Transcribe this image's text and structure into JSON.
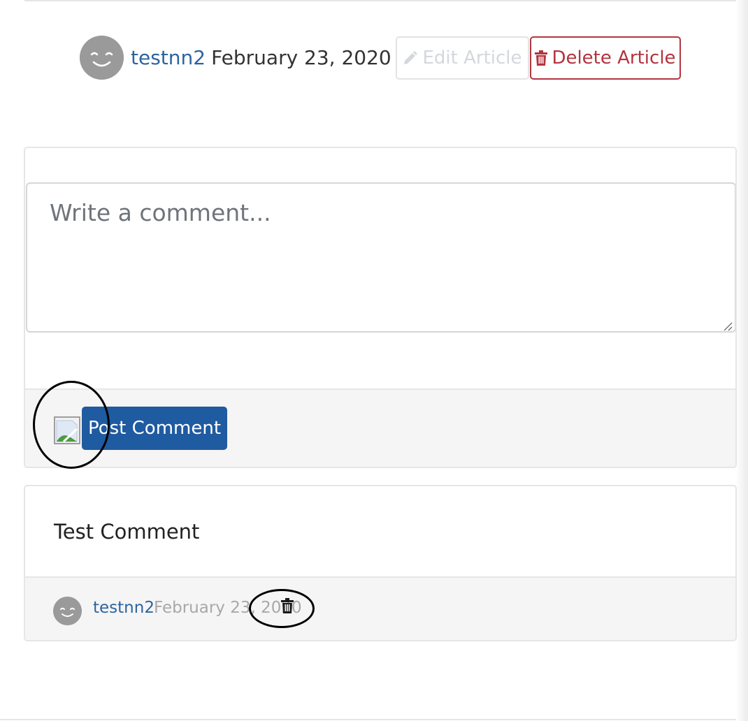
{
  "article_meta": {
    "author": "testnn2",
    "date": "February 23, 2020",
    "avatar_icon": "smiley-avatar-icon"
  },
  "actions": {
    "edit_label": "Edit Article",
    "edit_icon": "pencil-icon",
    "delete_label": "Delete Article",
    "delete_icon": "trash-icon"
  },
  "comment_form": {
    "placeholder": "Write a comment...",
    "value": "",
    "avatar_icon": "broken-image-icon",
    "submit_label": "Post Comment"
  },
  "comments": [
    {
      "body": "Test Comment",
      "author": "testnn2",
      "date": "February 23, 2020",
      "delete_icon": "trash-icon"
    }
  ],
  "colors": {
    "link": "#2d64a0",
    "primary_button": "#1f5ba0",
    "danger": "#b3343f",
    "disabled_text": "#d4d7dc"
  }
}
